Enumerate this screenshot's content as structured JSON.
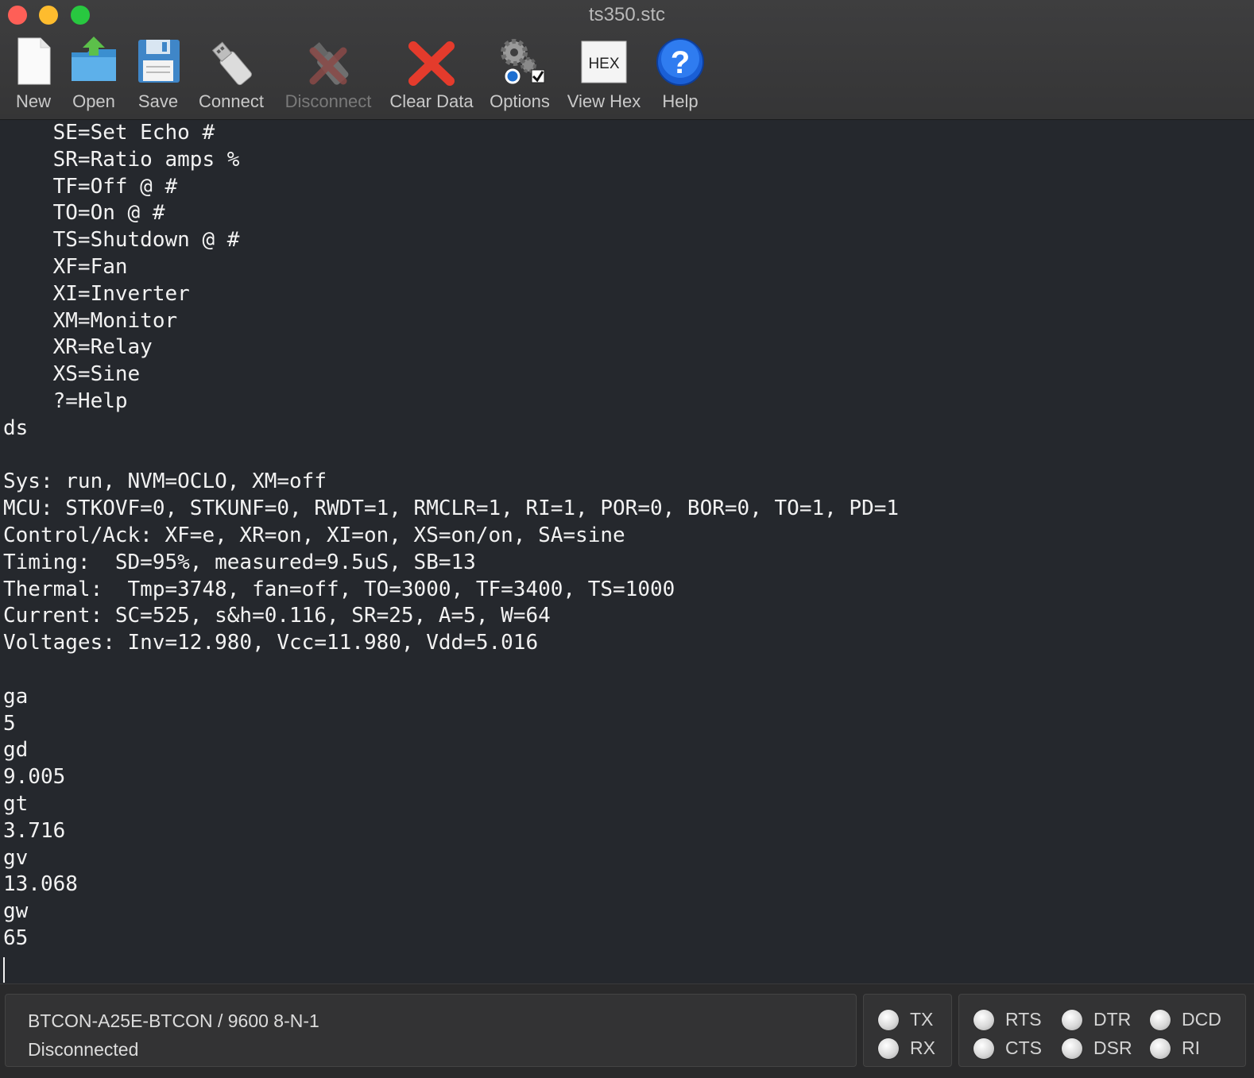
{
  "window": {
    "title": "ts350.stc"
  },
  "toolbar": {
    "items": [
      {
        "label": "New",
        "icon": "new-document-icon",
        "enabled": true
      },
      {
        "label": "Open",
        "icon": "open-folder-icon",
        "enabled": true
      },
      {
        "label": "Save",
        "icon": "floppy-disk-icon",
        "enabled": true
      },
      {
        "label": "Connect",
        "icon": "usb-plug-icon",
        "enabled": true
      },
      {
        "label": "Disconnect",
        "icon": "usb-disconnect-icon",
        "enabled": false
      },
      {
        "label": "Clear Data",
        "icon": "red-x-icon",
        "enabled": true
      },
      {
        "label": "Options",
        "icon": "gears-icon",
        "enabled": true
      },
      {
        "label": "View Hex",
        "icon": "hex-icon",
        "icon_text": "HEX",
        "enabled": true
      },
      {
        "label": "Help",
        "icon": "help-icon",
        "icon_text": "?",
        "enabled": true
      }
    ]
  },
  "terminal": {
    "lines": [
      "    SE=Set Echo #",
      "    SR=Ratio amps %",
      "    TF=Off @ #",
      "    TO=On @ #",
      "    TS=Shutdown @ #",
      "    XF=Fan",
      "    XI=Inverter",
      "    XM=Monitor",
      "    XR=Relay",
      "    XS=Sine",
      "    ?=Help",
      "ds",
      "",
      "Sys: run, NVM=OCLO, XM=off",
      "MCU: STKOVF=0, STKUNF=0, RWDT=1, RMCLR=1, RI=1, POR=0, BOR=0, TO=1, PD=1",
      "Control/Ack: XF=e, XR=on, XI=on, XS=on/on, SA=sine",
      "Timing:  SD=95%, measured=9.5uS, SB=13",
      "Thermal:  Tmp=3748, fan=off, TO=3000, TF=3400, TS=1000",
      "Current: SC=525, s&h=0.116, SR=25, A=5, W=64",
      "Voltages: Inv=12.980, Vcc=11.980, Vdd=5.016",
      "",
      "ga",
      "5",
      "gd",
      "9.005",
      "gt",
      "3.716",
      "gv",
      "13.068",
      "gw",
      "65"
    ]
  },
  "status": {
    "port": "BTCON-A25E-BTCON / 9600 8-N-1",
    "connection": "Disconnected",
    "indicators": {
      "tx": "TX",
      "rx": "RX",
      "rts": "RTS",
      "cts": "CTS",
      "dtr": "DTR",
      "dsr": "DSR",
      "dcd": "DCD",
      "ri": "RI"
    }
  },
  "colors": {
    "terminal_bg": "#25282d",
    "terminal_fg": "#f2f2f2",
    "toolbar_bg": "#3e3e3f",
    "close": "#fe5f57",
    "minimize": "#febc2e",
    "maximize": "#28c840"
  }
}
